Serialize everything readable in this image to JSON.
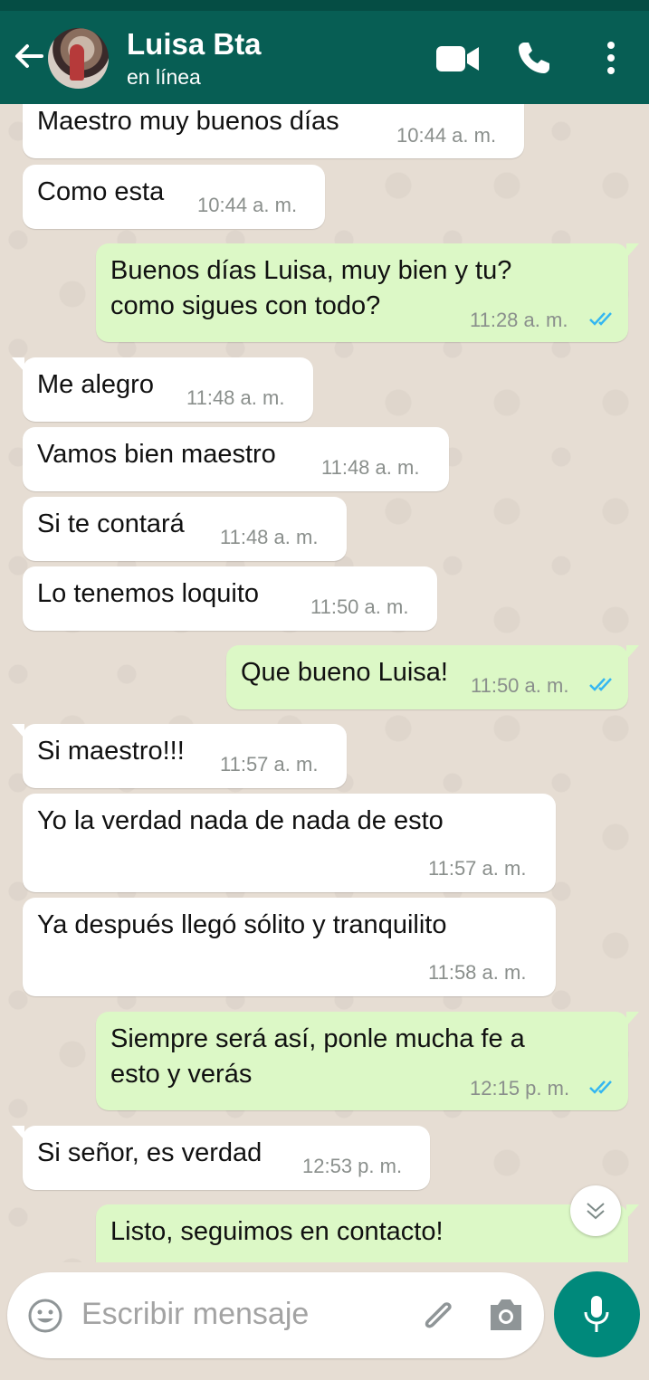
{
  "header": {
    "contact_name": "Luisa Bta",
    "presence": "en línea",
    "icons": [
      "back-arrow-icon",
      "avatar",
      "video-call-icon",
      "voice-call-icon",
      "more-options-icon"
    ]
  },
  "messages": [
    {
      "dir": "in",
      "text": "Maestro muy buenos días",
      "time": "10:44 a. m."
    },
    {
      "dir": "in",
      "text": "Como esta",
      "time": "10:44 a. m."
    },
    {
      "dir": "out",
      "text": "Buenos días Luisa, muy bien y tu?\ncomo sigues con todo?",
      "time": "11:28 a. m.",
      "read": true
    },
    {
      "dir": "in",
      "text": "Me alegro",
      "time": "11:48 a. m."
    },
    {
      "dir": "in",
      "text": "Vamos bien maestro",
      "time": "11:48 a. m."
    },
    {
      "dir": "in",
      "text": "Si te contará",
      "time": "11:48 a. m."
    },
    {
      "dir": "in",
      "text": "Lo tenemos loquito",
      "time": "11:50 a. m."
    },
    {
      "dir": "out",
      "text": "Que bueno Luisa!",
      "time": "11:50 a. m.",
      "read": true
    },
    {
      "dir": "in",
      "text": "Si maestro!!!",
      "time": "11:57 a. m."
    },
    {
      "dir": "in",
      "text": "Yo la verdad nada de nada de esto",
      "time": "11:57 a. m."
    },
    {
      "dir": "in",
      "text": "Ya después llegó sólito y tranquilito",
      "time": "11:58 a. m."
    },
    {
      "dir": "out",
      "text": "Siempre será así, ponle mucha fe a\nesto y verás",
      "time": "12:15 p. m.",
      "read": true
    },
    {
      "dir": "in",
      "text": "Si señor, es verdad",
      "time": "12:53 p. m."
    },
    {
      "dir": "out",
      "text": "Listo, seguimos en contacto!",
      "time": ""
    }
  ],
  "composer": {
    "placeholder": "Escribir mensaje",
    "icons": [
      "emoji-icon",
      "attach-icon",
      "camera-icon",
      "mic-icon"
    ]
  },
  "colors": {
    "header": "#075e54",
    "incoming_bubble": "#ffffff",
    "outgoing_bubble": "#dcf8c6",
    "read_ticks": "#34b7f1",
    "mic_button": "#00897b"
  }
}
